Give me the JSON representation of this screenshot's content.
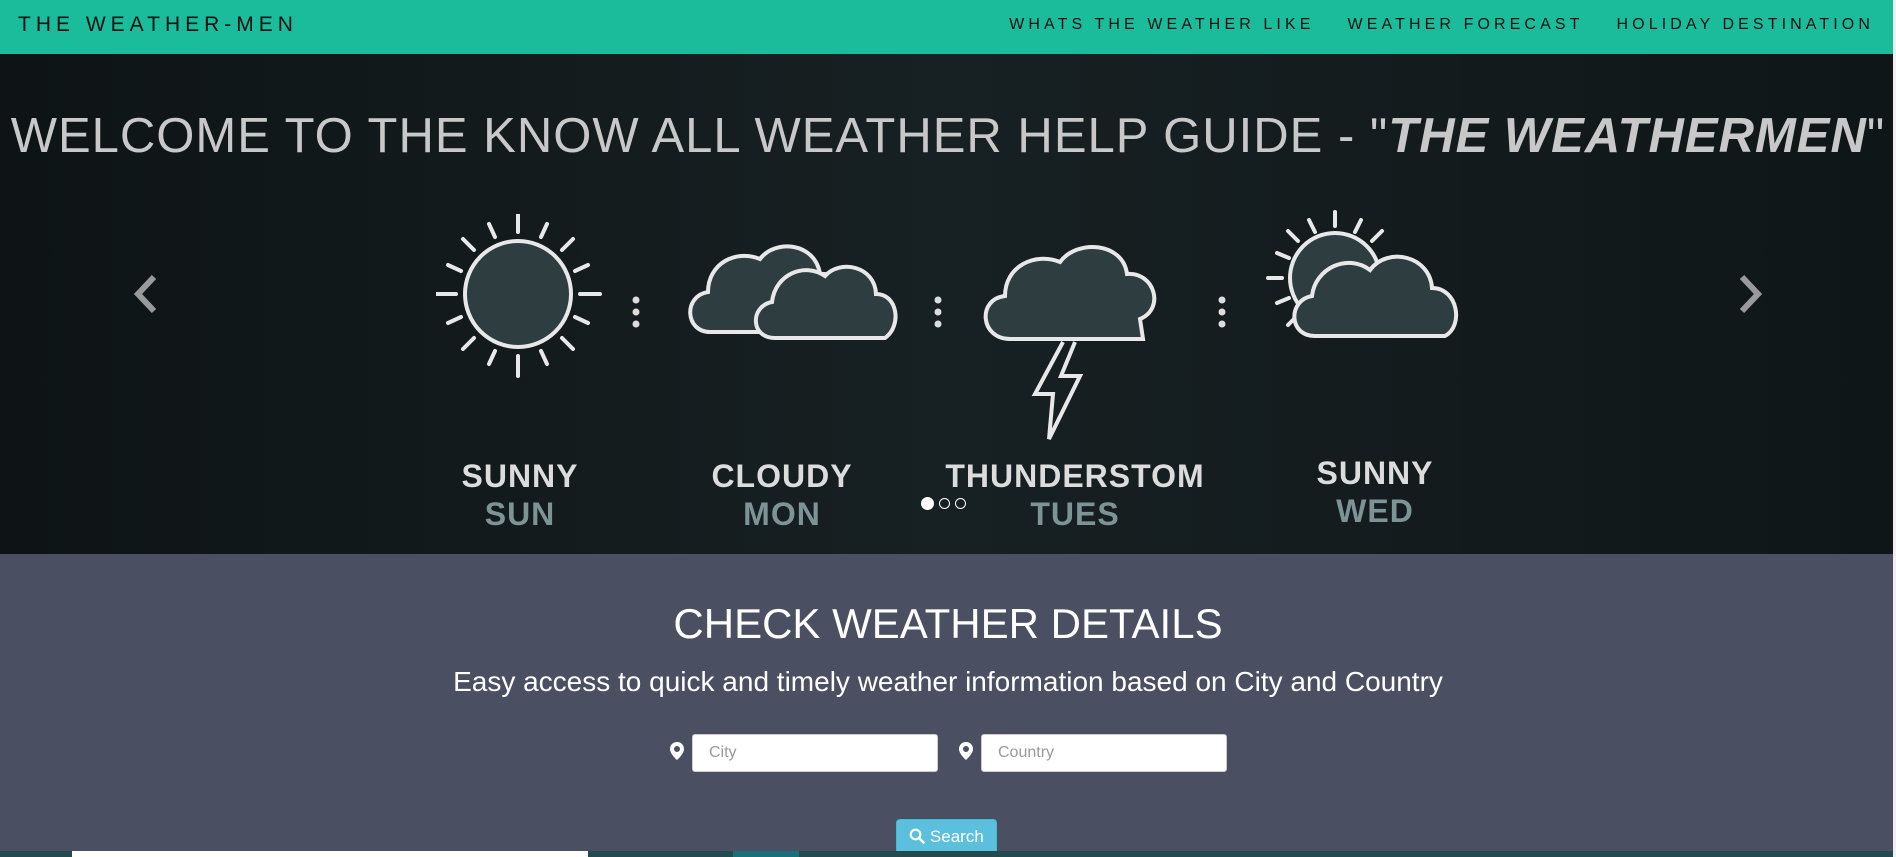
{
  "navbar": {
    "brand": "THE WEATHER-MEN",
    "links": [
      "WHATS THE WEATHER LIKE",
      "WEATHER FORECAST",
      "HOLIDAY DESTINATION"
    ]
  },
  "carousel": {
    "welcome_prefix": "WELCOME TO THE KNOW ALL WEATHER HELP GUIDE - \"",
    "welcome_emphasis": "THE WEATHERMEN",
    "welcome_suffix": "\"",
    "days": [
      {
        "condition": "SUNNY",
        "day": "SUN",
        "icon": "sun-icon"
      },
      {
        "condition": "CLOUDY",
        "day": "MON",
        "icon": "cloud-icon"
      },
      {
        "condition": "THUNDERSTOM",
        "day": "TUES",
        "icon": "thunderstorm-icon"
      },
      {
        "condition": "SUNNY",
        "day": "WED",
        "icon": "partly-sunny-icon"
      }
    ],
    "active_slide": 1,
    "slide_count": 3
  },
  "weather": {
    "title": "CHECK WEATHER DETAILS",
    "subtitle": "Easy access to quick and timely weather information based on City and Country",
    "city_placeholder": "City",
    "country_placeholder": "Country",
    "search_label": "Search"
  },
  "colors": {
    "navbar": "#1abc9c",
    "section": "#4a5061",
    "button": "#5bc0de"
  }
}
